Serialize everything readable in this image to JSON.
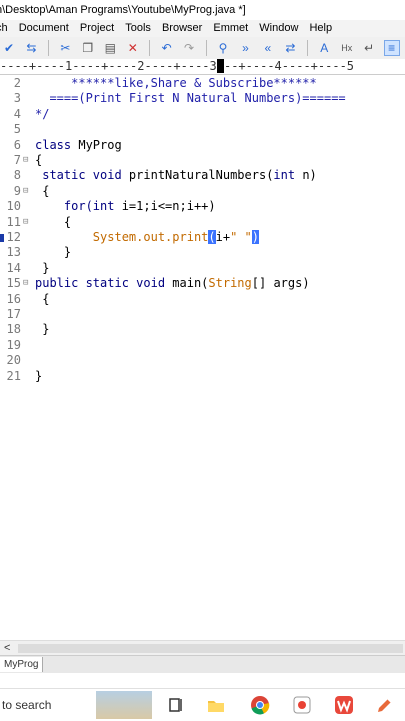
{
  "window": {
    "title": "h\\Desktop\\Aman Programs\\Youtube\\MyProg.java *]"
  },
  "menu": {
    "items": [
      "ch",
      "Document",
      "Project",
      "Tools",
      "Browser",
      "Emmet",
      "Window",
      "Help"
    ]
  },
  "toolbar": {
    "icons": [
      "check-icon",
      "toggle-icon",
      "cut-icon",
      "copy-icon",
      "paste-icon",
      "delete-icon",
      "undo-icon",
      "redo-icon",
      "find-icon",
      "find-next-icon",
      "find-prev-icon",
      "replace-icon",
      "font-icon",
      "hex-icon",
      "wrap-icon",
      "lines-icon",
      "grid-icon",
      "settings-icon",
      "panel-icon",
      "layout-icon"
    ]
  },
  "ruler": {
    "text": "----+----1----+----2----+----3",
    "cursor": "-",
    "text_after": "--+----4----+----5"
  },
  "editor": {
    "lines": [
      {
        "n": "2",
        "fold": "",
        "marker": false
      },
      {
        "n": "3",
        "fold": "",
        "marker": false
      },
      {
        "n": "4",
        "fold": "",
        "marker": false
      },
      {
        "n": "5",
        "fold": "",
        "marker": false
      },
      {
        "n": "6",
        "fold": "",
        "marker": false
      },
      {
        "n": "7",
        "fold": "⊟",
        "marker": false
      },
      {
        "n": "8",
        "fold": "",
        "marker": false
      },
      {
        "n": "9",
        "fold": "⊟",
        "marker": false
      },
      {
        "n": "10",
        "fold": "",
        "marker": false
      },
      {
        "n": "11",
        "fold": "⊟",
        "marker": false
      },
      {
        "n": "12",
        "fold": "",
        "marker": true
      },
      {
        "n": "13",
        "fold": "",
        "marker": false
      },
      {
        "n": "14",
        "fold": "",
        "marker": false
      },
      {
        "n": "15",
        "fold": "⊟",
        "marker": false
      },
      {
        "n": "16",
        "fold": "",
        "marker": false
      },
      {
        "n": "17",
        "fold": "",
        "marker": false
      },
      {
        "n": "18",
        "fold": "",
        "marker": false
      },
      {
        "n": "19",
        "fold": "",
        "marker": false
      },
      {
        "n": "20",
        "fold": "",
        "marker": false
      },
      {
        "n": "21",
        "fold": "",
        "marker": false
      }
    ],
    "code": {
      "l2": "     ******like,Share & Subscribe******",
      "l3": "  ====(Print First N Natural Numbers)======",
      "l4": "*/",
      "l6a": "class",
      "l6b": " MyProg",
      "l7": "{",
      "l8a": " static void",
      "l8b": " printNaturalNumbers(",
      "l8c": "int",
      "l8d": " n)",
      "l9": " {",
      "l10a": "    for(",
      "l10b": "int",
      "l10c": " i=1;i<=n;i++)",
      "l11": "    {",
      "l12a": "        System",
      "l12b": ".out.print",
      "l12c": "(",
      "l12d": "i+",
      "l12e": "\" \"",
      "l12f": ")",
      "l13": "    }",
      "l14": " }",
      "l15a": "public static void",
      "l15b": " main(",
      "l15c": "String",
      "l15d": "[] args)",
      "l16": " {",
      "l18": " }",
      "l21": "}"
    }
  },
  "scroll": {
    "left_arrow": "<"
  },
  "filetabs": {
    "active": "MyProg"
  },
  "taskbar": {
    "search_text": "e to search"
  }
}
